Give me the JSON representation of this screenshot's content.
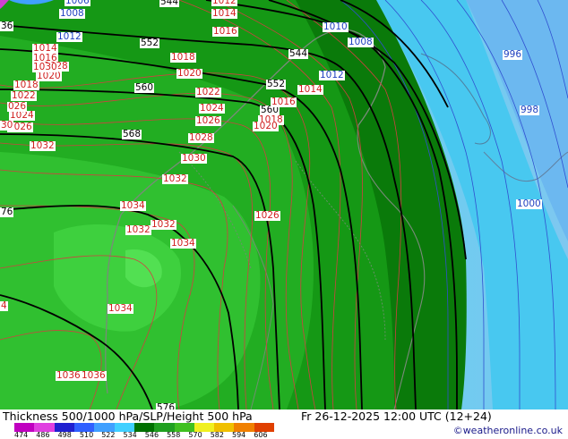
{
  "footer": {
    "title": "Thickness 500/1000 hPa/SLP/Height 500 hPa",
    "valid": "Fr 26-12-2025 12:00 UTC (12+24)",
    "credit": "©weatheronline.co.uk"
  },
  "legend": {
    "labels": [
      "474",
      "486",
      "498",
      "510",
      "522",
      "534",
      "546",
      "558",
      "570",
      "582",
      "594",
      "606"
    ],
    "colors": [
      "#c000c0",
      "#e040e0",
      "#2020d0",
      "#3060ff",
      "#40a0ff",
      "#40d0ff",
      "#007000",
      "#20a020",
      "#40c020",
      "#f0f020",
      "#f0c000",
      "#f08000",
      "#e04000"
    ]
  },
  "height_labels": [
    {
      "text": "544",
      "color": "#000000"
    },
    {
      "text": "552",
      "color": "#000000"
    },
    {
      "text": "560",
      "color": "#000000"
    },
    {
      "text": "568",
      "color": "#000000"
    },
    {
      "text": "544",
      "color": "#000000"
    },
    {
      "text": "552",
      "color": "#000000"
    },
    {
      "text": "560",
      "color": "#000000"
    },
    {
      "text": "576",
      "color": "#000000"
    },
    {
      "text": "576",
      "color": "#000000"
    },
    {
      "text": "36",
      "color": "#000000"
    },
    {
      "text": "76",
      "color": "#000000"
    }
  ],
  "slp_red": [
    "1014",
    "1016",
    "1012",
    "1014",
    "1016",
    "1018",
    "1020",
    "1022",
    "1024",
    "1026",
    "1028",
    "1030",
    "1032",
    "1034",
    "1036",
    "1018",
    "1020",
    "1022",
    "1024",
    "1026",
    "1028",
    "1030",
    "1032",
    "1032",
    "1032",
    "1034",
    "1034",
    "1036",
    "1016",
    "1018",
    "1020",
    "1026",
    "1014",
    "30",
    "4",
    "026"
  ],
  "slp_blue": [
    "1006",
    "1008",
    "1012",
    "1010",
    "1008",
    "1012",
    "996",
    "998",
    "1000"
  ]
}
